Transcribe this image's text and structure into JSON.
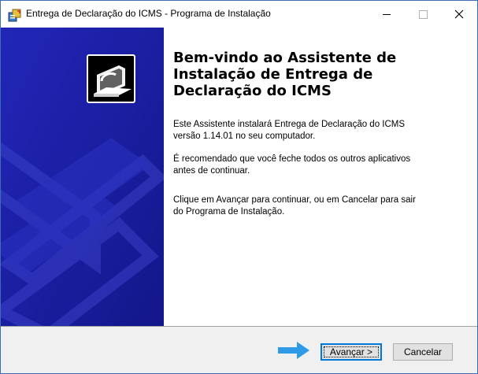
{
  "window": {
    "title": "Entrega de Declaração do ICMS - Programa de Instalação",
    "minimize_glyph": "",
    "close_glyph": "✕"
  },
  "content": {
    "heading_line1": "Bem-vindo ao Assistente de",
    "heading_line2": "Instalação de Entrega de",
    "heading_line3": "Declaração do ICMS",
    "para1_line1": "Este Assistente instalará Entrega de Declaração do ICMS",
    "para1_line2": "versão 1.14.01 no seu computador.",
    "para2_line1": "É recomendado que você feche todos os outros aplicativos",
    "para2_line2": "antes de continuar.",
    "para3_line1": "Clique em Avançar para continuar, ou em Cancelar para sair",
    "para3_line2": "do Programa de Instalação."
  },
  "footer": {
    "next_label": "Avançar >",
    "cancel_label": "Cancelar"
  },
  "icons": {
    "app": "installer-box-icon",
    "banner": "computer-install-icon",
    "pointer": "arrow-right-icon"
  },
  "colors": {
    "banner_bg": "#1a1fa0",
    "arrow": "#2f9be8",
    "focus": "#0078d7"
  }
}
